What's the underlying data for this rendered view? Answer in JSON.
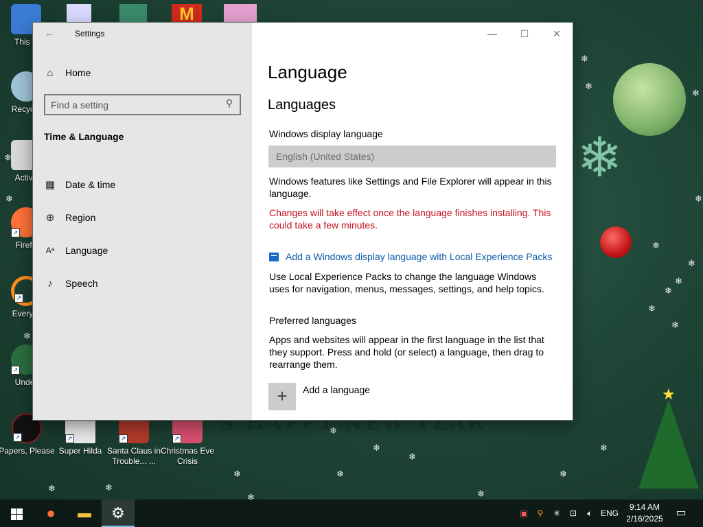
{
  "desktop": {
    "icons": [
      {
        "label": "This P",
        "color": "#3a7bd5"
      },
      {
        "label": "Recycle",
        "color": "#9fc4d8"
      },
      {
        "label": "Activa",
        "color": "#d8d8d8"
      },
      {
        "label": "Firefo",
        "color": "#ff7139"
      },
      {
        "label": "Everyth",
        "color": "#ff8c1a"
      },
      {
        "label": "Under",
        "color": "#2b6e3f"
      },
      {
        "label": "Papers, Please",
        "color": "#8b1a1a"
      },
      {
        "label": "Super Hilda",
        "color": "#e8e8e8"
      },
      {
        "label": "Santa Claus in Trouble... ...",
        "color": "#b33a2a"
      },
      {
        "label": "Christmas Eve Crisis",
        "color": "#d94f70"
      }
    ],
    "banner": "S HAPPY NEW YEAR"
  },
  "window": {
    "app_title": "Settings",
    "back_glyph": "←",
    "controls": {
      "minimize": "—",
      "maximize": "☐",
      "close": "✕"
    },
    "sidebar": {
      "home": {
        "icon": "⌂",
        "label": "Home"
      },
      "search": {
        "placeholder": "Find a setting",
        "icon": "⚲"
      },
      "section": "Time & Language",
      "items": [
        {
          "icon": "▦",
          "label": "Date & time"
        },
        {
          "icon": "⊕",
          "label": "Region"
        },
        {
          "icon": "Aᵃ",
          "label": "Language"
        },
        {
          "icon": "♪",
          "label": "Speech"
        }
      ]
    },
    "content": {
      "title": "Language",
      "subtitle": "Languages",
      "display_language_label": "Windows display language",
      "display_language_value": "English (United States)",
      "display_desc": "Windows features like Settings and File Explorer will appear in this language.",
      "warning": "Changes will take effect once the language finishes installing. This could take a few minutes.",
      "lxp_link": "Add a Windows display language with Local Experience Packs",
      "lxp_desc": "Use Local Experience Packs to change the language Windows uses for navigation, menus, messages, settings, and help topics.",
      "preferred_label": "Preferred languages",
      "preferred_desc": "Apps and websites will appear in the first language in the list that they support. Press and hold (or select) a language, then drag to rearrange them.",
      "add_language": {
        "icon": "+",
        "label": "Add a language"
      }
    }
  },
  "taskbar": {
    "pinned": [
      {
        "name": "firefox",
        "glyph": "●",
        "color": "#ff7139"
      },
      {
        "name": "file-explorer",
        "glyph": "▬",
        "color": "#f3c041"
      },
      {
        "name": "settings",
        "glyph": "⚙",
        "color": "#ffffff"
      }
    ],
    "tray": {
      "language": "ENG",
      "time": "9:14 AM",
      "date": "2/16/2025"
    }
  }
}
